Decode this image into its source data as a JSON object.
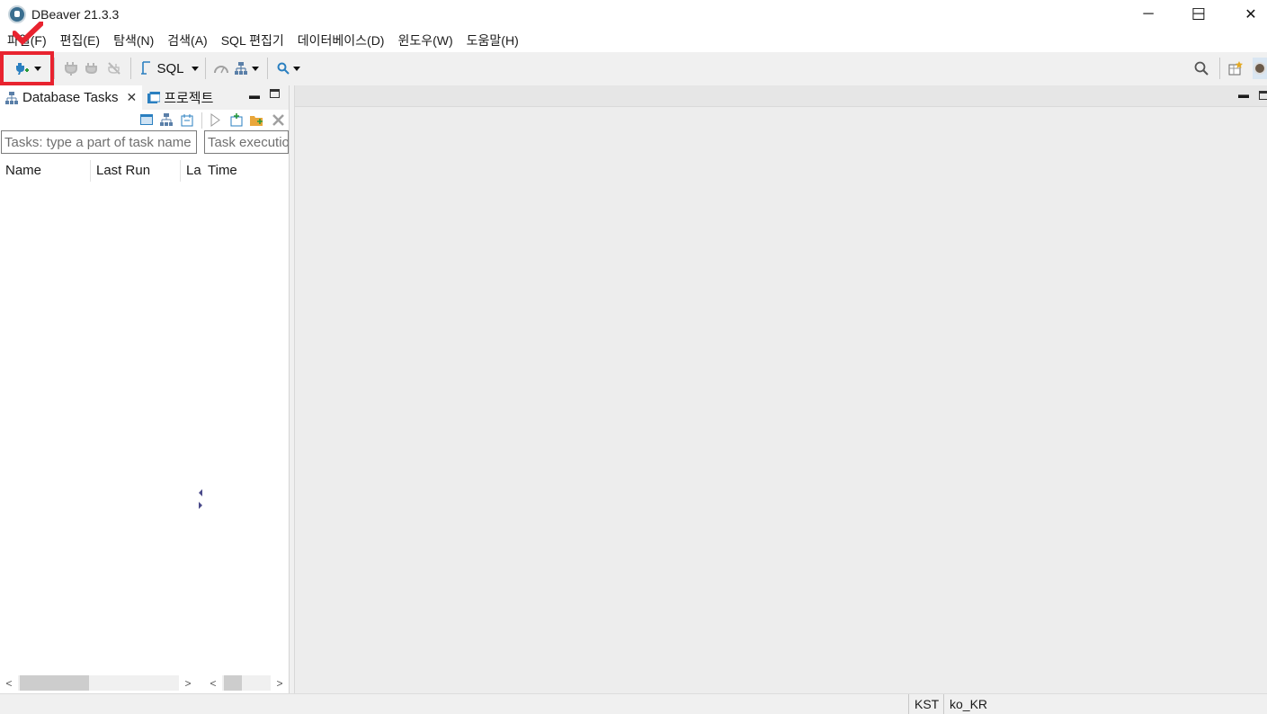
{
  "window": {
    "title": "DBeaver 21.3.3",
    "minimize_glyph": "─",
    "maximize_glyph": "☐",
    "close_glyph": "✕"
  },
  "menubar": {
    "items": [
      "파일(F)",
      "편집(E)",
      "탐색(N)",
      "검색(A)",
      "SQL 편집기",
      "데이터베이스(D)",
      "윈도우(W)",
      "도움말(H)"
    ]
  },
  "toolbar": {
    "sql_label": "SQL",
    "annotation_color": "#e8232f"
  },
  "left_panel": {
    "tabs": [
      {
        "label": "Database Tasks",
        "close": "✕",
        "active": true
      },
      {
        "label": "프로젝트",
        "active": false
      }
    ],
    "minimize_glyph": "▬",
    "task_filter_placeholder": "Tasks: type a part of task name",
    "execution_filter_placeholder": "Task execution",
    "columns": [
      "Name",
      "Last Run",
      "La",
      "Time"
    ],
    "scroll_left": "<",
    "scroll_right": ">"
  },
  "editor": {
    "minimize_glyph": "▬"
  },
  "statusbar": {
    "timezone": "KST",
    "locale": "ko_KR"
  },
  "colors": {
    "accent": "#2a7fc0",
    "highlight_box": "#e8232f",
    "background": "#f0f0f0"
  }
}
